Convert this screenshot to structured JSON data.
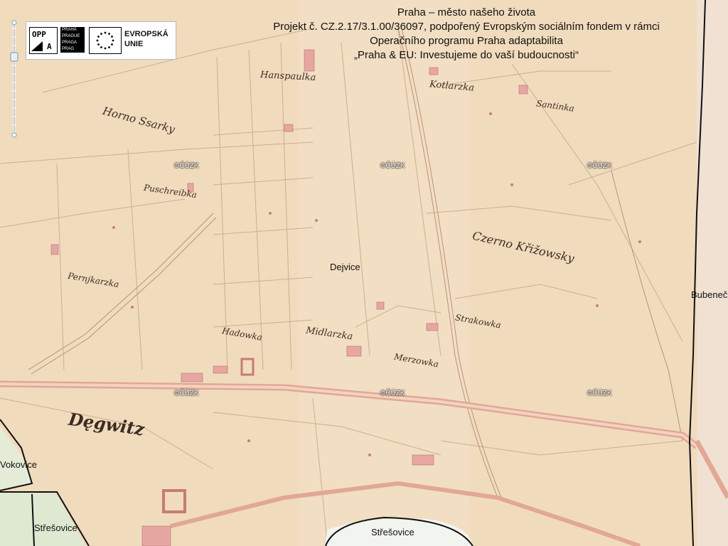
{
  "header": {
    "line1": "Praha – město našeho života",
    "line2": "Projekt č. CZ.2.17/3.1.00/36097, podpořený Evropským sociálním fondem v rámci",
    "line3": "Operačního programu Praha adaptabilita",
    "line4": "„Praha & EU: Investujeme do vaší budoucnosti“"
  },
  "logo": {
    "opp_top": "OPP",
    "opp_bottom": "A",
    "praha_lines": [
      "PRAHA",
      "PRAGUE",
      "PRAGA",
      "PRAG"
    ],
    "eu_line1": "EVROPSKÁ",
    "eu_line2": "UNIE"
  },
  "watermark": "©ČÚZK",
  "historic_labels": {
    "hanspaulka": "Hanspaulka",
    "kotlarzka": "Kotlarzka",
    "santinka": "Santinka",
    "horno_ssarky": "Horno Ssarky",
    "puschreibka": "Puschreibka",
    "czerno_krizowsky": "Czerno Křižowsky",
    "pernjkarzka": "Pernjkarzka",
    "hadowka": "Hadowka",
    "midlarzka": "Midlarzka",
    "strakowka": "Strakowka",
    "merzowka": "Merzowka",
    "degwitz": "Dęgwitz"
  },
  "modern_labels": {
    "dejvice": "Dejvice",
    "bubenec": "Bubeneč",
    "vokovice": "Vokovice",
    "stresovice_left": "Střešovice",
    "stresovice_bottom": "Střešovice"
  },
  "colors": {
    "paper": "#f2dcc0",
    "road": "#d9a08c",
    "boundary": "#111111",
    "green_area": "#e4ecd8"
  }
}
